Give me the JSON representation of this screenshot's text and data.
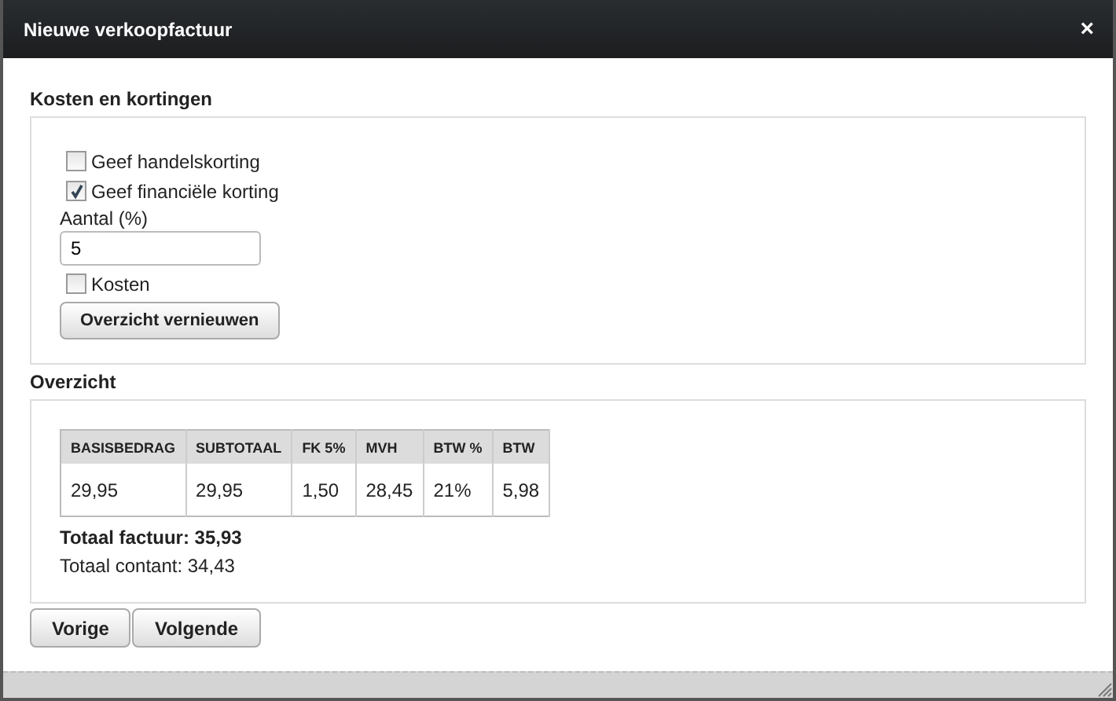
{
  "window": {
    "title": "Nieuwe verkoopfactuur",
    "close": "×"
  },
  "sections": [
    {
      "title": "Kosten en kortingen",
      "controls": [
        {
          "kind": "checkbox",
          "label": "Geef handelskorting",
          "checked": false
        },
        {
          "kind": "checkbox",
          "label": "Geef financiële korting",
          "checked": true
        },
        {
          "kind": "field",
          "label": "Aantal (%)",
          "value": "5"
        },
        {
          "kind": "checkbox",
          "label": "Kosten",
          "checked": false
        },
        {
          "kind": "button",
          "label": "Overzicht vernieuwen"
        }
      ]
    },
    {
      "title": "Overzicht",
      "table": {
        "columns": [
          "BASISBEDRAG",
          "SUBTOTAAL",
          "FK 5%",
          "MVH",
          "BTW %",
          "BTW"
        ],
        "rows": [
          [
            "29,95",
            "29,95",
            "1,50",
            "28,45",
            "21%",
            "5,98"
          ]
        ]
      },
      "totals": [
        {
          "text": "Totaal factuur: 35,93",
          "bold": true
        },
        {
          "text": "Totaal contant: 34,43",
          "bold": false
        }
      ]
    }
  ],
  "buttons": [
    "Vorige",
    "Volgende"
  ]
}
